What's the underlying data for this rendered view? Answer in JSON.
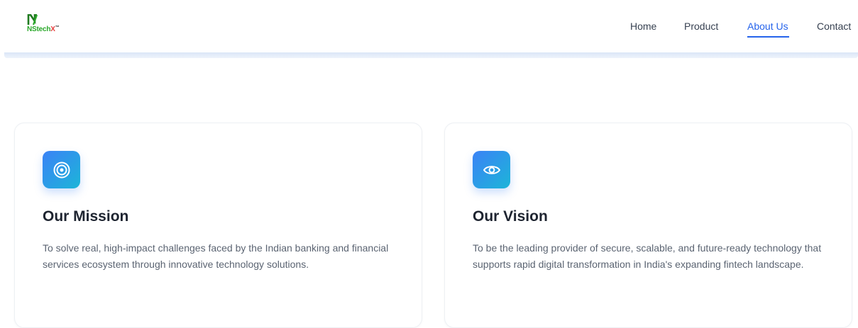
{
  "brand": {
    "logo_ns": "NStech",
    "logo_x": "X",
    "logo_tm": "™",
    "colors": {
      "green": "#2aa82a",
      "red": "#e43d3d"
    }
  },
  "nav": {
    "items": [
      {
        "label": "Home",
        "active": false
      },
      {
        "label": "Product",
        "active": false
      },
      {
        "label": "About Us",
        "active": true
      },
      {
        "label": "Contact",
        "active": false
      }
    ],
    "active_color": "#2563eb"
  },
  "cards": [
    {
      "icon": "target-icon",
      "title": "Our Mission",
      "text": "To solve real, high-impact challenges faced by the Indian banking and financial services ecosystem through innovative technology solutions."
    },
    {
      "icon": "eye-icon",
      "title": "Our Vision",
      "text": "To be the leading provider of secure, scalable, and future-ready technology that supports rapid digital transformation in India's expanding fintech landscape."
    }
  ],
  "accent_gradient": [
    "#3b82f6",
    "#1cb5d8"
  ]
}
